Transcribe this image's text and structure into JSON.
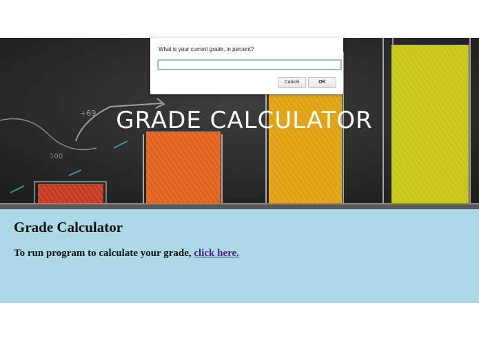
{
  "banner": {
    "title": "GRADE CALCULATOR"
  },
  "page": {
    "heading": "Grade Calculator",
    "instruction": "To run program to calculate your grade,",
    "link_text": "click here."
  },
  "dialog": {
    "message": "What is your current grade, in percent?",
    "input_value": "",
    "cancel_label": "Cancel",
    "ok_label": "OK"
  },
  "colors": {
    "content_bg": "#add8e6",
    "bar_red": "#c63a22",
    "bar_orange": "#e0631e",
    "bar_amber": "#e0a214",
    "bar_yellow": "#c6c616"
  }
}
